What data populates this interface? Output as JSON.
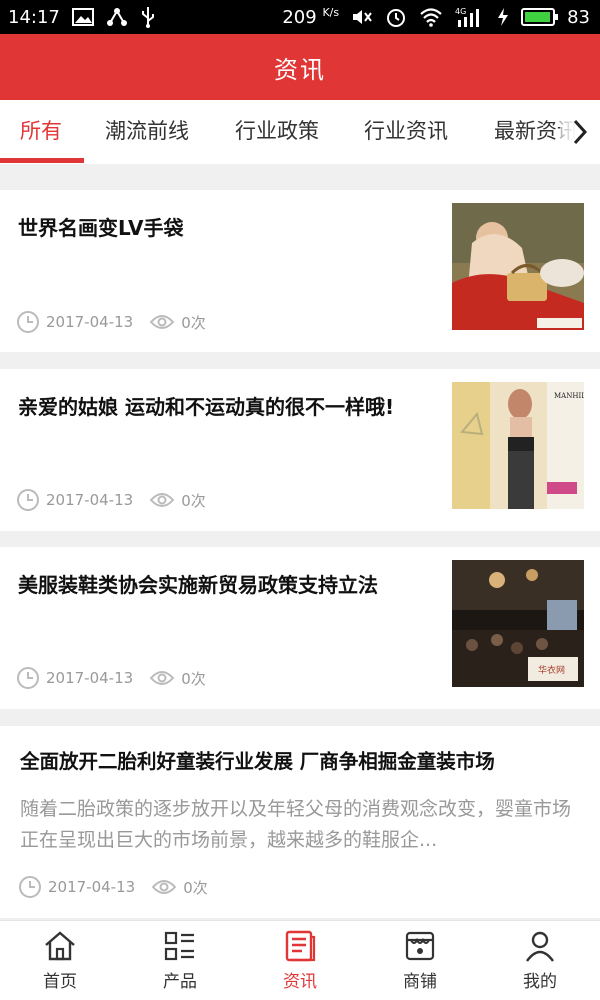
{
  "status_bar": {
    "time": "14:17",
    "speed": "209",
    "speed_unit": "K/s",
    "network": "4G",
    "battery": "83"
  },
  "header": {
    "title": "资讯"
  },
  "tabs": [
    {
      "label": "所有",
      "active": true
    },
    {
      "label": "潮流前线",
      "active": false
    },
    {
      "label": "行业政策",
      "active": false
    },
    {
      "label": "行业资讯",
      "active": false
    },
    {
      "label": "最新资讯",
      "active": false
    }
  ],
  "news": [
    {
      "title": "世界名画变LV手袋",
      "date": "2017-04-13",
      "views": "0次"
    },
    {
      "title": "亲爱的姑娘 运动和不运动真的很不一样哦!",
      "date": "2017-04-13",
      "views": "0次",
      "thumb_text": "MANHILL"
    },
    {
      "title": "美服装鞋类协会实施新贸易政策支持立法",
      "date": "2017-04-13",
      "views": "0次",
      "thumb_text": "华衣网"
    },
    {
      "title": "全面放开二胎利好童装行业发展 厂商争相掘金童装市场",
      "description": "随着二胎政策的逐步放开以及年轻父母的消费观念改变，婴童市场正在呈现出巨大的市场前景，越来越多的鞋服企...",
      "date": "2017-04-13",
      "views": "0次"
    }
  ],
  "bottom_nav": [
    {
      "label": "首页",
      "icon": "home-icon",
      "active": false
    },
    {
      "label": "产品",
      "icon": "grid-list-icon",
      "active": false
    },
    {
      "label": "资讯",
      "icon": "news-icon",
      "active": true
    },
    {
      "label": "商铺",
      "icon": "shop-icon",
      "active": false
    },
    {
      "label": "我的",
      "icon": "user-icon",
      "active": false
    }
  ],
  "colors": {
    "accent": "#e03636",
    "muted": "#999999"
  }
}
